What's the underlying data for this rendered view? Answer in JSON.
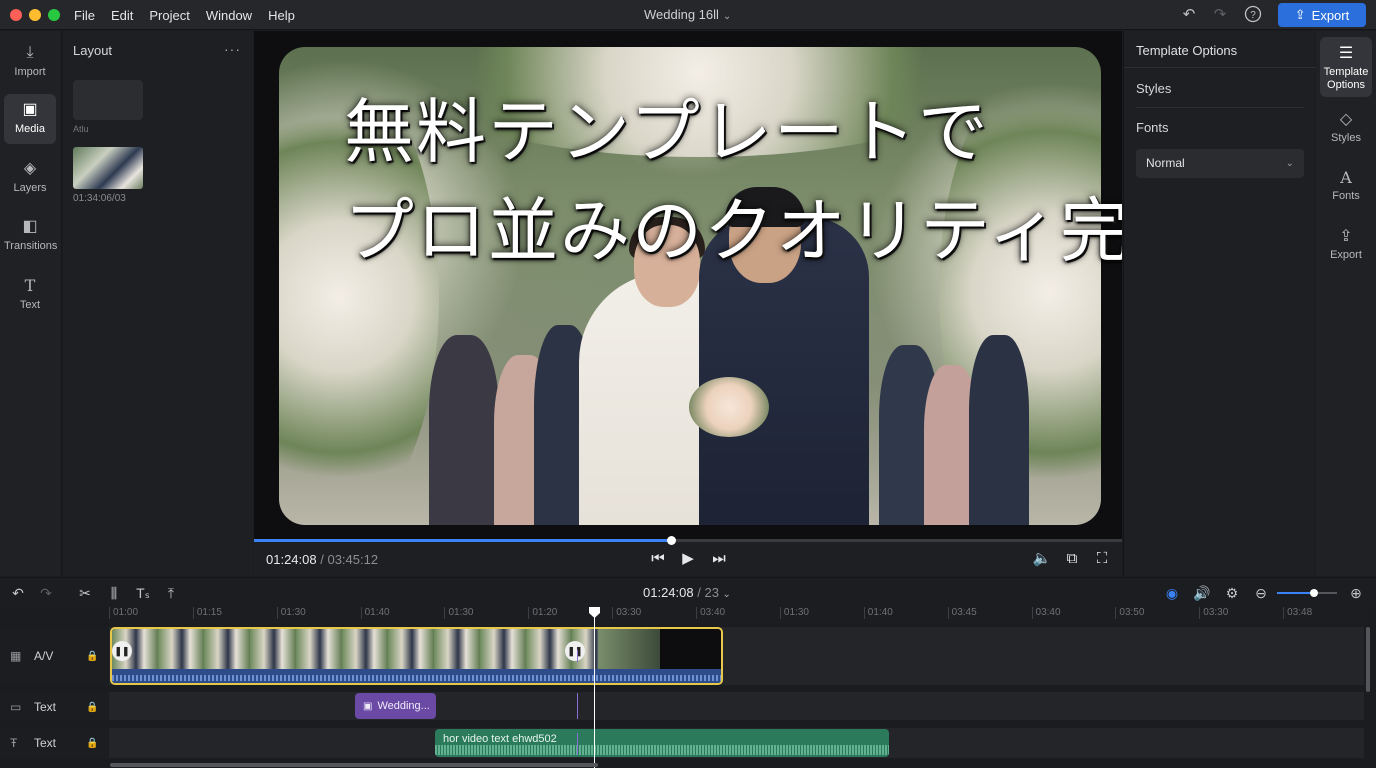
{
  "window": {
    "menu": [
      "File",
      "Edit",
      "Project",
      "Window",
      "Help"
    ],
    "doc_title": "Wedding 16ll",
    "export_label": "Export"
  },
  "left_rail": [
    {
      "label": "Import",
      "icon": "import-icon"
    },
    {
      "label": "Media",
      "icon": "media-icon",
      "active": true
    },
    {
      "label": "Layers",
      "icon": "layers-icon"
    },
    {
      "label": "Transitions",
      "icon": "transitions-icon"
    },
    {
      "label": "Text",
      "icon": "text-icon"
    }
  ],
  "layout_panel": {
    "title": "Layout",
    "card_label": "Atlu",
    "thumb_time": "01:34:06/03"
  },
  "preview": {
    "overlay_line1": "無料テンプレートで",
    "overlay_line2": "プロ並みのクオリティ完成",
    "progress": 0.48
  },
  "playback": {
    "current": "01:24:08",
    "total": "/ 03:45:12"
  },
  "right_panel": {
    "title": "Template Options",
    "styles_label": "Styles",
    "fonts_label": "Fonts",
    "font_weight_value": "Normal"
  },
  "right_rail": [
    {
      "label": "Template Options",
      "icon": "template-options-icon",
      "active": true
    },
    {
      "label": "Styles",
      "icon": "styles-icon"
    },
    {
      "label": "Fonts",
      "icon": "fonts-icon"
    },
    {
      "label": "Export",
      "icon": "export-icon"
    }
  ],
  "timeline": {
    "time": "01:24:08",
    "total": "/ 23",
    "zoom": 0.62,
    "ruler": [
      "01:00",
      "01:15",
      "01:30",
      "01:40",
      "01:30",
      "01:20",
      "03:30",
      "03:40",
      "01:30",
      "01:40",
      "03:45",
      "03:40",
      "03:50",
      "03:30",
      "03:48"
    ],
    "tracks": [
      {
        "label": "A/V",
        "icon": "film-icon"
      },
      {
        "label": "Text",
        "icon": "text-track-icon"
      },
      {
        "label": "Text",
        "icon": "text-track-icon"
      }
    ],
    "text_clip_label": "Wedding...",
    "audio_clip_label": "hor video text ehwd502"
  },
  "colors": {
    "accent": "#2a6fdb",
    "av_clip_border": "#e8c84a",
    "text_clip": "#6a4aa5",
    "audio_clip": "#2b7a5c"
  }
}
